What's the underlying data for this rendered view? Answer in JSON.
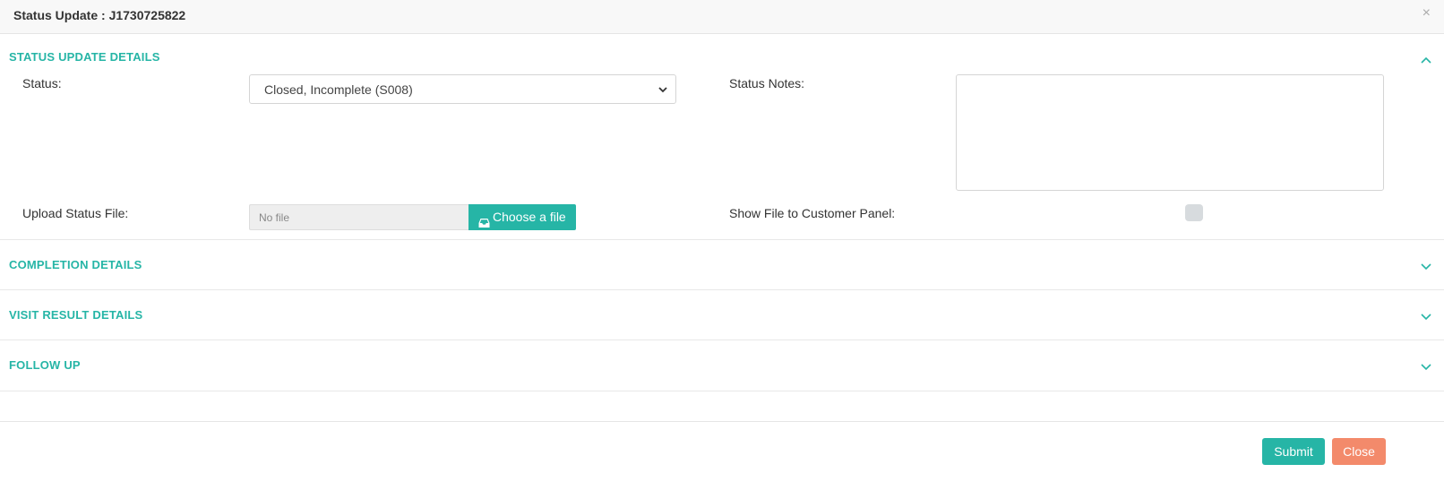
{
  "modal": {
    "title": "Status Update : J1730725822",
    "close_glyph": "×"
  },
  "sections": {
    "status_update": {
      "title": "STATUS UPDATE DETAILS",
      "expanded": true,
      "chevron": "chevron-up-icon"
    },
    "completion": {
      "title": "COMPLETION DETAILS",
      "expanded": false,
      "chevron": "chevron-down-icon"
    },
    "visit_result": {
      "title": "VISIT RESULT DETAILS",
      "expanded": false,
      "chevron": "chevron-down-icon"
    },
    "follow_up": {
      "title": "FOLLOW UP",
      "expanded": false,
      "chevron": "chevron-down-icon"
    }
  },
  "form": {
    "status_label": "Status:",
    "status_value": "Closed, Incomplete (S008)",
    "status_notes_label": "Status Notes:",
    "status_notes_value": "",
    "upload_label": "Upload Status File:",
    "upload_placeholder": "No file",
    "upload_button_label": "Choose a file",
    "upload_button_icon": "inbox-icon",
    "show_file_label": "Show File to Customer Panel:",
    "show_file_checked": false
  },
  "footer": {
    "submit_label": "Submit",
    "close_label": "Close"
  },
  "colors": {
    "accent": "#26b5a6",
    "close_button": "#f38a6b",
    "header_bg": "#f8f8f8"
  }
}
